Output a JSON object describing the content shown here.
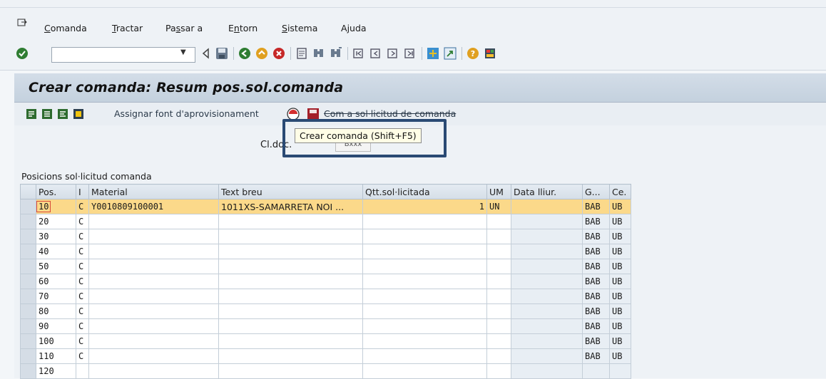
{
  "menu": {
    "items": [
      {
        "pre": "",
        "u": "C",
        "post": "omanda"
      },
      {
        "pre": "",
        "u": "T",
        "post": "ractar"
      },
      {
        "pre": "Pa",
        "u": "s",
        "post": "sar a"
      },
      {
        "pre": "E",
        "u": "n",
        "post": "torn"
      },
      {
        "pre": "",
        "u": "S",
        "post": "istema"
      },
      {
        "pre": "A",
        "u": "j",
        "post": "uda"
      }
    ]
  },
  "toolbar": {
    "command_field_value": "",
    "icons": [
      "enter-icon",
      "back-icon",
      "save-icon",
      "back-nav-icon",
      "exit-icon",
      "cancel-icon",
      "print-icon",
      "find-icon",
      "find-next-icon",
      "first-page-icon",
      "previous-page-icon",
      "next-page-icon",
      "last-page-icon",
      "new-session-icon",
      "shortcut-icon",
      "help-icon",
      "layout-menu-icon"
    ]
  },
  "title": "Crear comanda: Resum pos.sol.comanda",
  "app_toolbar": {
    "assign_label": "Assignar font d'aprovisionament",
    "convert_label": "Com a sol·licitud de comanda"
  },
  "header": {
    "cldoc_label": "Cl.doc.",
    "cldoc_value": "Bxxx"
  },
  "tooltip": "Crear comanda   (Shift+F5)",
  "section_title": "Posicions sol·licitud comanda",
  "table": {
    "columns": [
      "Pos.",
      "I",
      "Material",
      "Text breu",
      "Qtt.sol·licitada",
      "UM",
      "Data lliur.",
      "G...",
      "Ce."
    ],
    "rows": [
      {
        "pos": "10",
        "i": "C",
        "material": "Y0010809100001",
        "text": "1011XS-SAMARRETA NOI ...",
        "qty": "1",
        "um": "UN",
        "date": "",
        "g": "BAB",
        "ce": "UB",
        "highlight": true
      },
      {
        "pos": "20",
        "i": "C",
        "material": "",
        "text": "",
        "qty": "",
        "um": "",
        "date": "",
        "g": "BAB",
        "ce": "UB"
      },
      {
        "pos": "30",
        "i": "C",
        "material": "",
        "text": "",
        "qty": "",
        "um": "",
        "date": "",
        "g": "BAB",
        "ce": "UB"
      },
      {
        "pos": "40",
        "i": "C",
        "material": "",
        "text": "",
        "qty": "",
        "um": "",
        "date": "",
        "g": "BAB",
        "ce": "UB"
      },
      {
        "pos": "50",
        "i": "C",
        "material": "",
        "text": "",
        "qty": "",
        "um": "",
        "date": "",
        "g": "BAB",
        "ce": "UB"
      },
      {
        "pos": "60",
        "i": "C",
        "material": "",
        "text": "",
        "qty": "",
        "um": "",
        "date": "",
        "g": "BAB",
        "ce": "UB"
      },
      {
        "pos": "70",
        "i": "C",
        "material": "",
        "text": "",
        "qty": "",
        "um": "",
        "date": "",
        "g": "BAB",
        "ce": "UB"
      },
      {
        "pos": "80",
        "i": "C",
        "material": "",
        "text": "",
        "qty": "",
        "um": "",
        "date": "",
        "g": "BAB",
        "ce": "UB"
      },
      {
        "pos": "90",
        "i": "C",
        "material": "",
        "text": "",
        "qty": "",
        "um": "",
        "date": "",
        "g": "BAB",
        "ce": "UB"
      },
      {
        "pos": "100",
        "i": "C",
        "material": "",
        "text": "",
        "qty": "",
        "um": "",
        "date": "",
        "g": "BAB",
        "ce": "UB"
      },
      {
        "pos": "110",
        "i": "C",
        "material": "",
        "text": "",
        "qty": "",
        "um": "",
        "date": "",
        "g": "BAB",
        "ce": "UB"
      },
      {
        "pos": "120",
        "i": "",
        "material": "",
        "text": "",
        "qty": "",
        "um": "",
        "date": "",
        "g": "",
        "ce": ""
      }
    ]
  },
  "colors": {
    "highlight_row": "#fbd98a",
    "title_bar": "#c8d4e0",
    "tooltip_border": "#2a4a74"
  }
}
